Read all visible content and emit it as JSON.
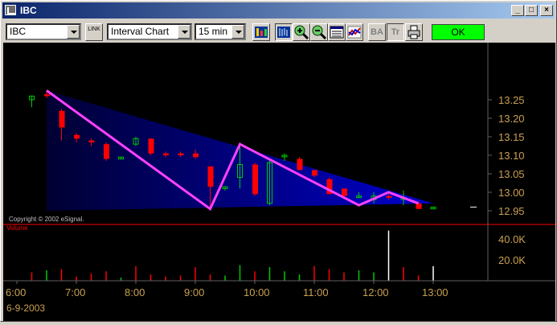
{
  "window": {
    "title": "IBC"
  },
  "caption_buttons": {
    "minimize": "_",
    "maximize": "□",
    "close": "×"
  },
  "toolbar": {
    "symbol": "IBC",
    "link_label": "LINK",
    "chart_type": "Interval Chart",
    "interval": "15 min",
    "ba_label": "BA",
    "tr_label": "Tr",
    "status": "OK",
    "status_color": "#00ff00",
    "icons": [
      "bar-style-icon",
      "ohlc-bars-icon",
      "zoom-in-icon",
      "zoom-out-icon",
      "data-window-icon",
      "studies-icon",
      "bid-ask-icon",
      "trade-icon",
      "print-icon"
    ]
  },
  "chart": {
    "copyright": "Copyright © 2002 eSignal.",
    "volume_label": "Volume",
    "date_label": "6-9-2003",
    "colors": {
      "up": "#00c800",
      "down": "#ff0000",
      "zigzag": "#ff40ff",
      "wedge": "#0000cc",
      "axis_text": "#c8a050"
    }
  },
  "chart_data": {
    "type": "candlestick",
    "x_tick_labels": [
      "6:00",
      "7:00",
      "8:00",
      "9:00",
      "10:00",
      "11:00",
      "12:00",
      "13:00"
    ],
    "y_tick_labels": [
      "13.25",
      "13.20",
      "13.15",
      "13.10",
      "13.05",
      "13.00",
      "12.95"
    ],
    "volume_tick_labels": [
      "40.0K",
      "20.0K"
    ],
    "ylim": [
      12.93,
      13.29
    ],
    "volume_ylim": [
      0,
      50000
    ],
    "candles": [
      {
        "time": "6:15",
        "open": 13.25,
        "high": 13.26,
        "low": 13.23,
        "close": 13.26
      },
      {
        "time": "6:30",
        "open": 13.265,
        "high": 13.275,
        "low": 13.255,
        "close": 13.26
      },
      {
        "time": "6:45",
        "open": 13.22,
        "high": 13.225,
        "low": 13.14,
        "close": 13.175
      },
      {
        "time": "7:00",
        "open": 13.155,
        "high": 13.16,
        "low": 13.135,
        "close": 13.145
      },
      {
        "time": "7:15",
        "open": 13.14,
        "high": 13.145,
        "low": 13.125,
        "close": 13.135
      },
      {
        "time": "7:30",
        "open": 13.13,
        "high": 13.135,
        "low": 13.085,
        "close": 13.09
      },
      {
        "time": "7:45",
        "open": 13.09,
        "high": 13.095,
        "low": 13.09,
        "close": 13.095
      },
      {
        "time": "8:00",
        "open": 13.13,
        "high": 13.15,
        "low": 13.125,
        "close": 13.145
      },
      {
        "time": "8:15",
        "open": 13.145,
        "high": 13.145,
        "low": 13.1,
        "close": 13.105
      },
      {
        "time": "8:30",
        "open": 13.105,
        "high": 13.11,
        "low": 13.095,
        "close": 13.1
      },
      {
        "time": "8:45",
        "open": 13.105,
        "high": 13.11,
        "low": 13.095,
        "close": 13.1
      },
      {
        "time": "9:00",
        "open": 13.105,
        "high": 13.115,
        "low": 13.09,
        "close": 13.095
      },
      {
        "time": "9:15",
        "open": 13.07,
        "high": 13.07,
        "low": 12.96,
        "close": 13.015
      },
      {
        "time": "9:30",
        "open": 13.01,
        "high": 13.015,
        "low": 13.005,
        "close": 13.015
      },
      {
        "time": "9:45",
        "open": 13.04,
        "high": 13.13,
        "low": 13.01,
        "close": 13.075
      },
      {
        "time": "10:00",
        "open": 13.075,
        "high": 13.08,
        "low": 12.99,
        "close": 12.995
      },
      {
        "time": "10:15",
        "open": 12.97,
        "high": 13.085,
        "low": 12.965,
        "close": 13.08
      },
      {
        "time": "10:30",
        "open": 13.1,
        "high": 13.105,
        "low": 13.085,
        "close": 13.1
      },
      {
        "time": "10:45",
        "open": 13.09,
        "high": 13.095,
        "low": 13.06,
        "close": 13.06
      },
      {
        "time": "11:00",
        "open": 13.06,
        "high": 13.06,
        "low": 13.04,
        "close": 13.045
      },
      {
        "time": "11:15",
        "open": 13.035,
        "high": 13.04,
        "low": 12.995,
        "close": 12.995
      },
      {
        "time": "11:30",
        "open": 13.01,
        "high": 13.01,
        "low": 12.99,
        "close": 12.99
      },
      {
        "time": "11:45",
        "open": 12.99,
        "high": 13.0,
        "low": 12.985,
        "close": 12.99
      },
      {
        "time": "12:00",
        "open": 12.98,
        "high": 13.0,
        "low": 12.97,
        "close": 12.99
      },
      {
        "time": "12:15",
        "open": 12.99,
        "high": 12.995,
        "low": 12.98,
        "close": 12.985
      },
      {
        "time": "12:30",
        "open": 12.985,
        "high": 13.005,
        "low": 12.965,
        "close": 12.985
      },
      {
        "time": "12:45",
        "open": 12.97,
        "high": 12.975,
        "low": 12.955,
        "close": 12.955
      },
      {
        "time": "13:00",
        "open": 12.955,
        "high": 12.96,
        "low": 12.955,
        "close": 12.96
      }
    ],
    "volume": [
      {
        "time": "6:15",
        "value": 8000,
        "dir": "down"
      },
      {
        "time": "6:30",
        "value": 10000,
        "dir": "up"
      },
      {
        "time": "6:45",
        "value": 11000,
        "dir": "down"
      },
      {
        "time": "7:00",
        "value": 4000,
        "dir": "down"
      },
      {
        "time": "7:15",
        "value": 7000,
        "dir": "down"
      },
      {
        "time": "7:30",
        "value": 9000,
        "dir": "down"
      },
      {
        "time": "7:45",
        "value": 3000,
        "dir": "up"
      },
      {
        "time": "8:00",
        "value": 14000,
        "dir": "down"
      },
      {
        "time": "8:15",
        "value": 6000,
        "dir": "down"
      },
      {
        "time": "8:30",
        "value": 4000,
        "dir": "down"
      },
      {
        "time": "8:45",
        "value": 5000,
        "dir": "down"
      },
      {
        "time": "9:00",
        "value": 13000,
        "dir": "down"
      },
      {
        "time": "9:15",
        "value": 6000,
        "dir": "down"
      },
      {
        "time": "9:30",
        "value": 5000,
        "dir": "up"
      },
      {
        "time": "9:45",
        "value": 15000,
        "dir": "up"
      },
      {
        "time": "10:00",
        "value": 9000,
        "dir": "down"
      },
      {
        "time": "10:15",
        "value": 13000,
        "dir": "up"
      },
      {
        "time": "10:30",
        "value": 9000,
        "dir": "up"
      },
      {
        "time": "10:45",
        "value": 6000,
        "dir": "up"
      },
      {
        "time": "11:00",
        "value": 14000,
        "dir": "down"
      },
      {
        "time": "11:15",
        "value": 11000,
        "dir": "down"
      },
      {
        "time": "11:30",
        "value": 8000,
        "dir": "down"
      },
      {
        "time": "11:45",
        "value": 10000,
        "dir": "up"
      },
      {
        "time": "12:00",
        "value": 8000,
        "dir": "up"
      },
      {
        "time": "12:15",
        "value": 48000,
        "dir": "neutral"
      },
      {
        "time": "12:30",
        "value": 13000,
        "dir": "down"
      },
      {
        "time": "12:45",
        "value": 5000,
        "dir": "down"
      },
      {
        "time": "13:00",
        "value": 14000,
        "dir": "neutral"
      }
    ],
    "zigzag": [
      {
        "time": "6:30",
        "price": 13.275
      },
      {
        "time": "9:15",
        "price": 12.955
      },
      {
        "time": "9:45",
        "price": 13.13
      },
      {
        "time": "11:45",
        "price": 12.965
      },
      {
        "time": "12:15",
        "price": 13.0
      },
      {
        "time": "12:45",
        "price": 12.97
      }
    ],
    "wedge": {
      "upper": [
        {
          "time": "6:30",
          "price": 13.275
        },
        {
          "time": "13:00",
          "price": 12.97
        }
      ],
      "lower": [
        {
          "time": "6:30",
          "price": 12.95
        },
        {
          "time": "13:00",
          "price": 12.97
        }
      ]
    }
  }
}
